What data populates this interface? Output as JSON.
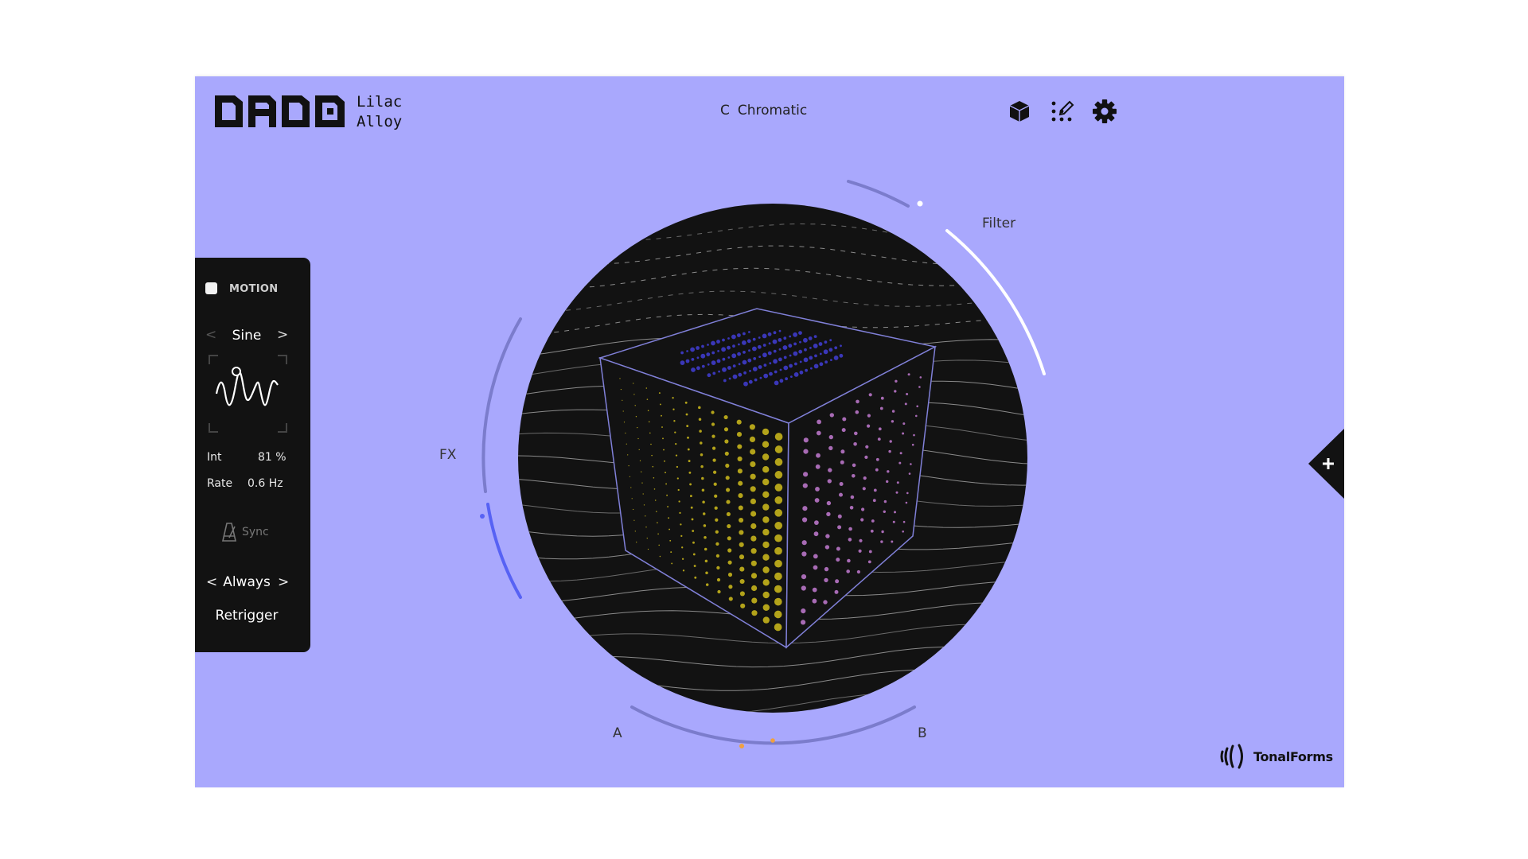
{
  "header": {
    "logo_text": "DADO",
    "preset_line1": "Lilac",
    "preset_line2": "Alloy",
    "scale_root": "C",
    "scale_name": "Chromatic",
    "icons": [
      "cube-icon",
      "edit-dots-icon",
      "gear-icon"
    ]
  },
  "motion": {
    "title": "MOTION",
    "enabled": false,
    "waveform": "Sine",
    "prev_arrow": "<",
    "next_arrow": ">",
    "int_label": "Int",
    "int_value": "81 %",
    "rate_label": "Rate",
    "rate_value": "0.6 Hz",
    "sync_label": "Sync",
    "trigger_mode": "Always",
    "retrigger_label": "Retrigger"
  },
  "controls": {
    "filter_label": "Filter",
    "fx_label": "FX",
    "a_label": "A",
    "b_label": "B"
  },
  "footer": {
    "brand": "TonalForms"
  },
  "side_tab": {
    "symbol": "+"
  },
  "colors": {
    "background": "#a9a8fd",
    "panel": "#121212",
    "orb": "#121212",
    "arc": "#7b7ccc",
    "filter_arc_active": "#ffffff",
    "fx_arc_active": "#5762f4",
    "ab_marker": "#f0a040",
    "dots_top": "#3a37b8",
    "dots_left": "#b3a31a",
    "dots_right": "#a86bb5"
  }
}
